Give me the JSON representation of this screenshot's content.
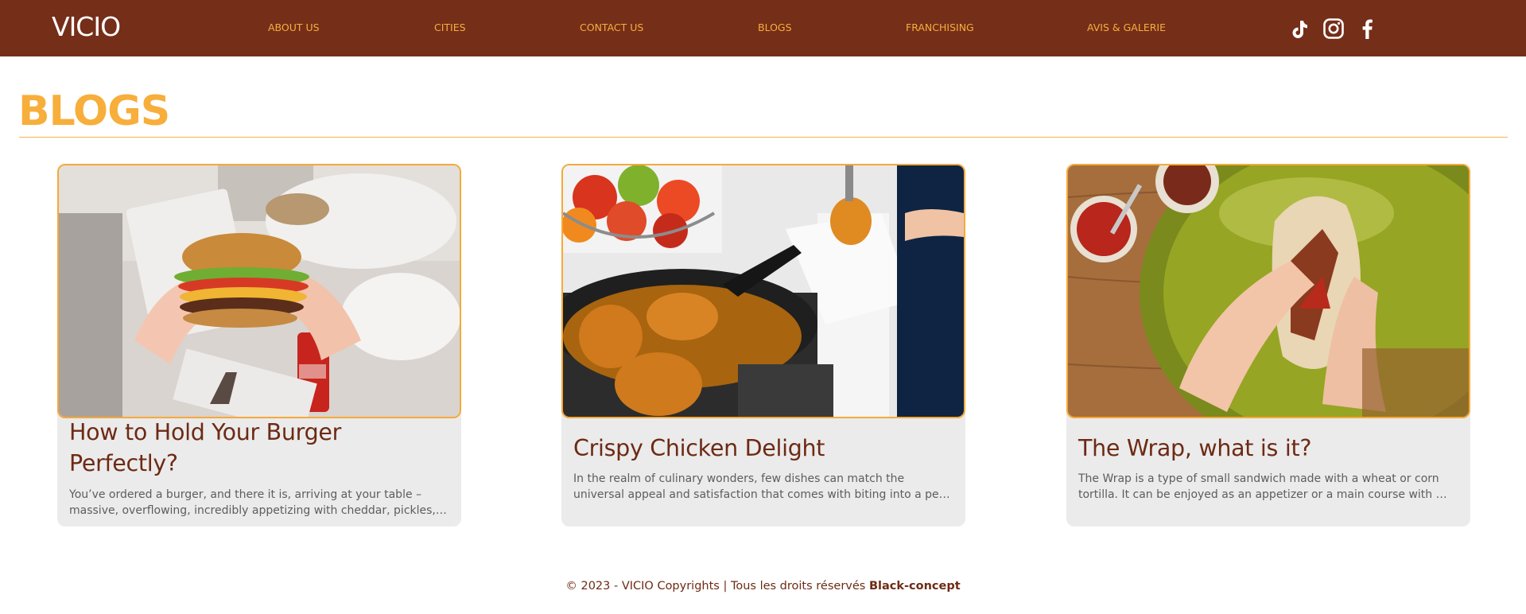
{
  "brand": {
    "logo_text": "VICIO"
  },
  "nav": {
    "items": [
      "ABOUT US",
      "CITIES",
      "CONTACT US",
      "BLOGS",
      "FRANCHISING",
      "AVIS & GALERIE"
    ]
  },
  "social": [
    "tiktok-icon",
    "instagram-icon",
    "facebook-icon"
  ],
  "page": {
    "title": "BLOGS"
  },
  "posts": [
    {
      "title_lines": [
        "How to Hold Your Burger",
        "Perfectly?"
      ],
      "excerpt_lines": [
        "You’ve ordered a burger, and there it is, arriving at your table –",
        "massive, overflowing, incredibly appetizing with cheddar, pickles, fresh lettuce and a juicy patty"
      ],
      "image_icon": "burger-photo"
    },
    {
      "title_lines": [
        "Crispy Chicken Delight"
      ],
      "excerpt_lines": [
        "In the realm of culinary wonders, few dishes can match the",
        "universal appeal and satisfaction that comes with biting into a perfectly fried piece of chicken"
      ],
      "image_icon": "fried-chicken-photo"
    },
    {
      "title_lines": [
        "The Wrap, what is it?"
      ],
      "excerpt_lines": [
        "The Wrap is a type of small sandwich made with a wheat or corn",
        "tortilla. It can be enjoyed as an appetizer or a main course with many fillings"
      ],
      "image_icon": "wrap-photo"
    }
  ],
  "footer": {
    "text": "© 2023 - VICIO Copyrights | Tous les droits réservés",
    "credit": "Black-concept"
  },
  "colors": {
    "header_bg": "#752e18",
    "accent": "#f6ae3d",
    "card_bg": "#ebebeb",
    "title_brown": "#6d2a14"
  }
}
